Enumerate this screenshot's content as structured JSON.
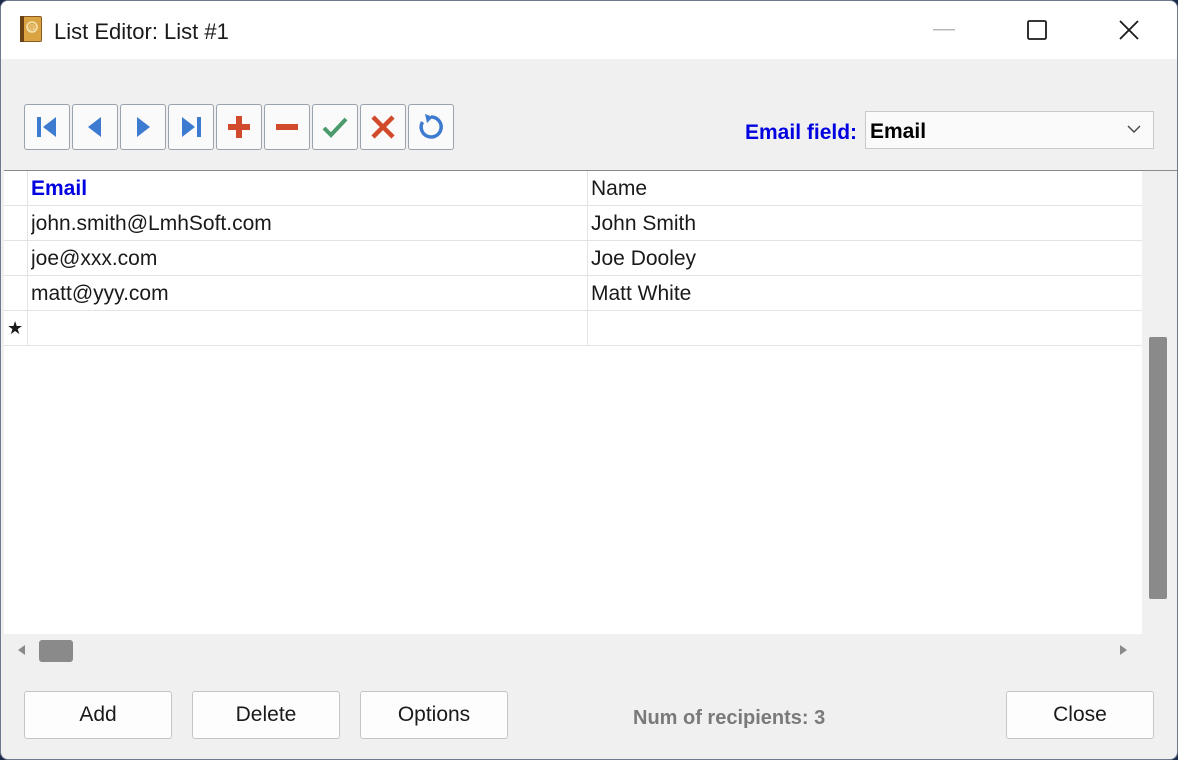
{
  "window": {
    "title": "List Editor: List #1",
    "controls": [
      "minimize-icon",
      "maximize-icon",
      "close-icon"
    ]
  },
  "toolbar": {
    "buttons": [
      {
        "name": "first-record",
        "icon": "first-record-icon",
        "color": "#3d7bd0"
      },
      {
        "name": "prior-record",
        "icon": "prior-record-icon",
        "color": "#3d7bd0"
      },
      {
        "name": "next-record",
        "icon": "next-record-icon",
        "color": "#3d7bd0"
      },
      {
        "name": "last-record",
        "icon": "last-record-icon",
        "color": "#3d7bd0"
      },
      {
        "name": "insert-record",
        "icon": "plus-icon",
        "color": "#d14a2b"
      },
      {
        "name": "delete-record",
        "icon": "minus-icon",
        "color": "#d14a2b"
      },
      {
        "name": "post-edit",
        "icon": "check-icon",
        "color": "#4a9a6b"
      },
      {
        "name": "cancel-edit",
        "icon": "x-icon",
        "color": "#d14a2b"
      },
      {
        "name": "refresh-data",
        "icon": "refresh-icon",
        "color": "#3d7bd0"
      }
    ]
  },
  "email_field": {
    "label": "Email field:",
    "value": "Email"
  },
  "grid": {
    "columns": [
      "Email",
      "Name"
    ],
    "rows": [
      {
        "email": "john.smith@LmhSoft.com",
        "name": "John Smith"
      },
      {
        "email": "joe@xxx.com",
        "name": "Joe Dooley"
      },
      {
        "email": "matt@yyy.com",
        "name": "Matt White"
      }
    ],
    "new_row_marker": "★"
  },
  "buttons": {
    "add": "Add",
    "delete": "Delete",
    "options": "Options",
    "close": "Close"
  },
  "status": {
    "recipients": "Num of recipients: 3"
  },
  "colors": {
    "accent": "#0000e0",
    "nav": "#3d7bd0",
    "danger": "#d14a2b",
    "ok": "#4a9a6b"
  }
}
